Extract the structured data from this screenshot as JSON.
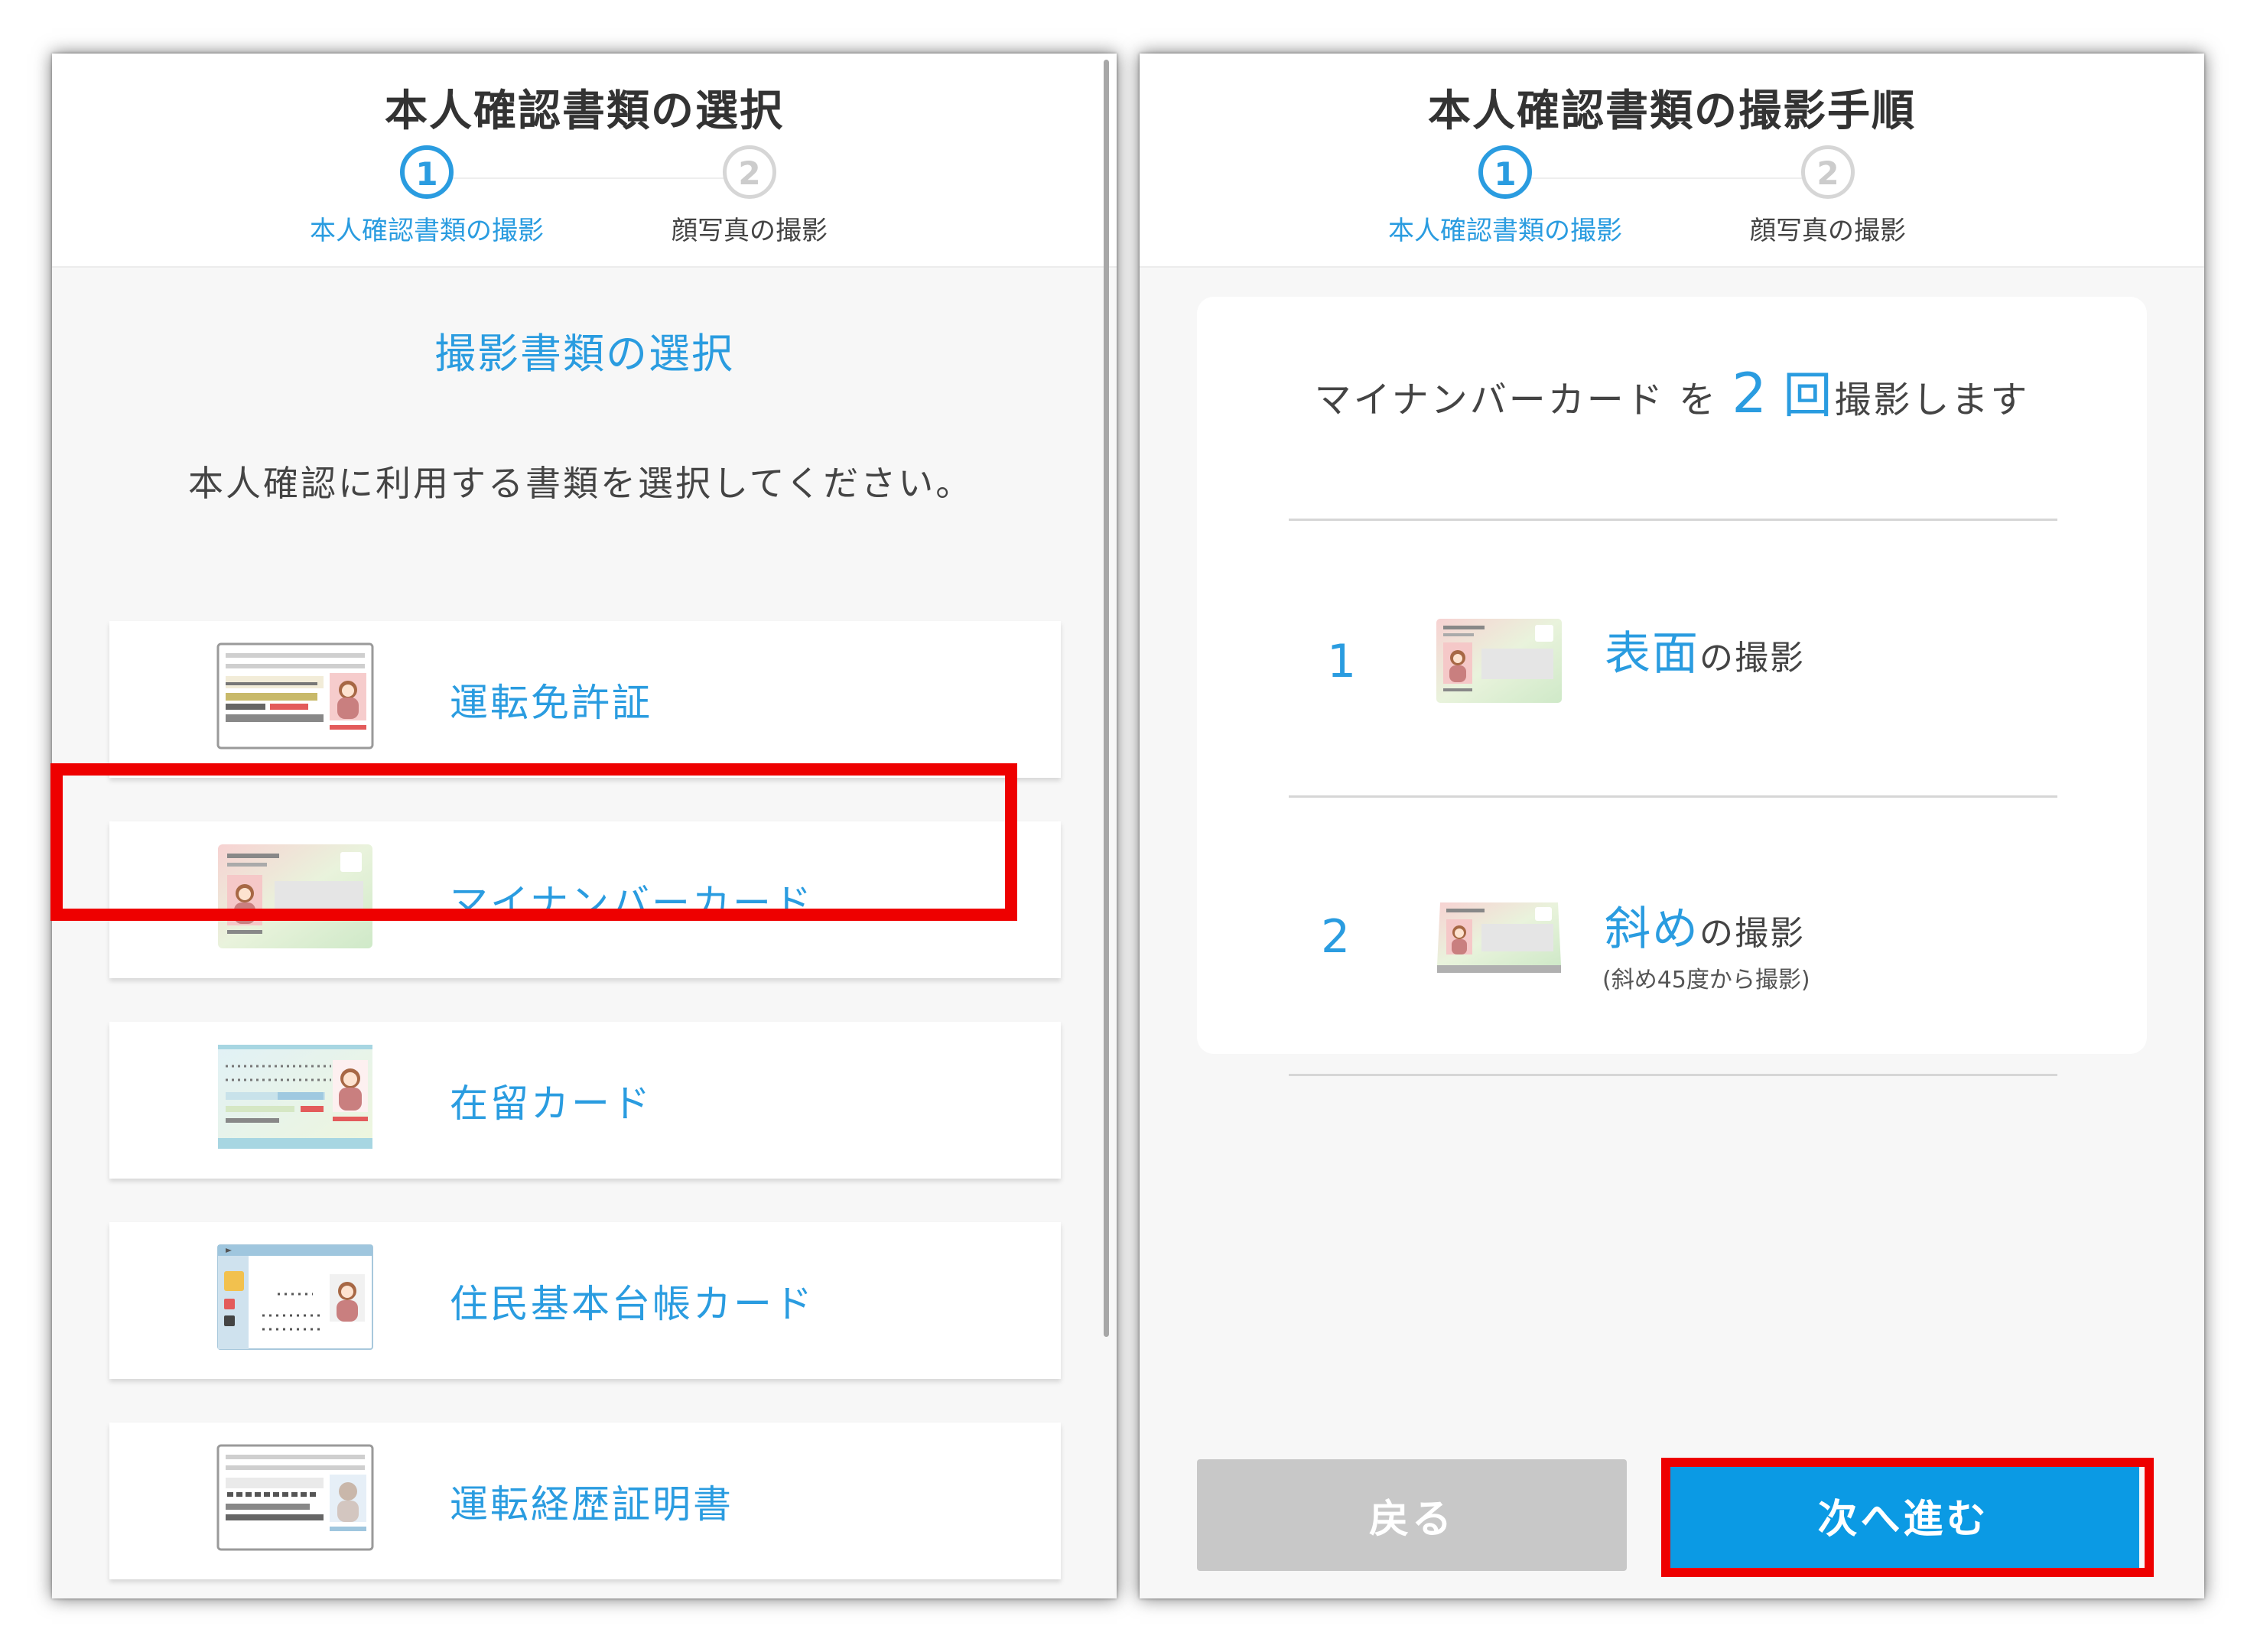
{
  "left_screen": {
    "title": "本人確認書類の選択",
    "steps": [
      {
        "number": "1",
        "label": "本人確認書類の撮影",
        "active": true
      },
      {
        "number": "2",
        "label": "顔写真の撮影",
        "active": false
      }
    ],
    "section_title": "撮影書類の選択",
    "instruction": "本人確認に利用する書類を選択してください。",
    "documents": [
      {
        "label": "運転免許証",
        "icon": "drivers-license-icon"
      },
      {
        "label": "マイナンバーカード",
        "icon": "my-number-card-icon",
        "highlighted": true
      },
      {
        "label": "在留カード",
        "icon": "residence-card-icon"
      },
      {
        "label": "住民基本台帳カード",
        "icon": "resident-registry-card-icon"
      },
      {
        "label": "運転経歴証明書",
        "icon": "driving-history-certificate-icon"
      }
    ]
  },
  "right_screen": {
    "title": "本人確認書類の撮影手順",
    "steps": [
      {
        "number": "1",
        "label": "本人確認書類の撮影",
        "active": true
      },
      {
        "number": "2",
        "label": "顔写真の撮影",
        "active": false
      }
    ],
    "summary": {
      "document": "マイナンバーカード",
      "particle": "を",
      "count": "2",
      "unit": "回",
      "suffix": "撮影します"
    },
    "shots": [
      {
        "number": "1",
        "highlight": "表面",
        "suffix": "の撮影",
        "note": ""
      },
      {
        "number": "2",
        "highlight": "斜め",
        "suffix": "の撮影",
        "note": "(斜め45度から撮影)"
      }
    ],
    "buttons": {
      "back": "戻る",
      "next": "次へ進む"
    }
  },
  "colors": {
    "accent": "#2a9ce0",
    "primary_button": "#0b9ae4",
    "disabled_button": "#c8c8c8",
    "annotation_red": "#ee0000"
  }
}
